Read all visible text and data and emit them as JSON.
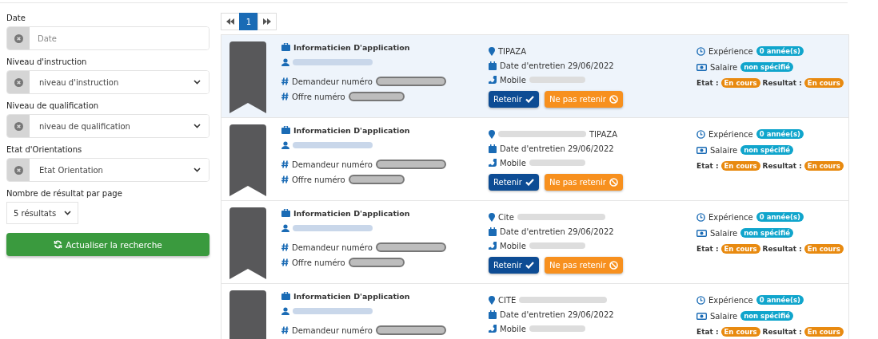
{
  "filters": [
    {
      "kind": "input",
      "label": "Date",
      "placeholder": "Date"
    },
    {
      "kind": "select",
      "label": "Niveau d'instruction",
      "value": "niveau d'instruction"
    },
    {
      "kind": "select",
      "label": "Niveau de qualification",
      "value": "niveau de qualification"
    },
    {
      "kind": "select",
      "label": "Etat d'Orientations",
      "value": "Etat Orientation"
    }
  ],
  "per_page": {
    "label": "Nombre de résultat par page",
    "value": "5 résultats"
  },
  "refresh_button": "Actualiser la recherche",
  "pagination": {
    "pages": [
      {
        "label": "1",
        "selected": true
      }
    ]
  },
  "results": [
    {
      "highlighted": true,
      "job": "Informaticien D'application",
      "applicant_label": "Demandeur numéro",
      "offer_label": "Offre numéro",
      "location": [
        {
          "kind": "text",
          "text": "TIPAZA"
        }
      ],
      "interview": "Date d'entretien 29/06/2022",
      "mobile_label": "Mobile",
      "buttons": {
        "accept": "Retenir",
        "reject": "Ne pas retenir"
      },
      "experience_label": "Expérience",
      "experience": "0 année(s)",
      "salary_label": "Salaire",
      "salary": "non spécifié",
      "state_label": "Etat :",
      "state": "En cours",
      "result_label": "Resultat :",
      "result": "En cours"
    },
    {
      "highlighted": false,
      "job": "Informaticien D'application",
      "applicant_label": "Demandeur numéro",
      "offer_label": "Offre numéro",
      "location": [
        {
          "kind": "redacted"
        },
        {
          "kind": "text",
          "text": "TIPAZA"
        }
      ],
      "interview": "Date d'entretien 29/06/2022",
      "mobile_label": "Mobile",
      "buttons": {
        "accept": "Retenir",
        "reject": "Ne pas retenir"
      },
      "experience_label": "Expérience",
      "experience": "0 année(s)",
      "salary_label": "Salaire",
      "salary": "non spécifié",
      "state_label": "Etat :",
      "state": "En cours",
      "result_label": "Resultat :",
      "result": "En cours"
    },
    {
      "highlighted": false,
      "job": "Informaticien D'application",
      "applicant_label": "Demandeur numéro",
      "offer_label": "Offre numéro",
      "location": [
        {
          "kind": "text",
          "text": "Cite"
        },
        {
          "kind": "redacted"
        }
      ],
      "interview": "Date d'entretien 29/06/2022",
      "mobile_label": "Mobile",
      "buttons": {
        "accept": "Retenir",
        "reject": "Ne pas retenir"
      },
      "experience_label": "Expérience",
      "experience": "0 année(s)",
      "salary_label": "Salaire",
      "salary": "non spécifié",
      "state_label": "Etat :",
      "state": "En cours",
      "result_label": "Resultat :",
      "result": "En cours"
    },
    {
      "highlighted": false,
      "job": "Informaticien D'application",
      "applicant_label": "Demandeur numéro",
      "location": [
        {
          "kind": "text",
          "text": "CITE"
        },
        {
          "kind": "redacted"
        }
      ],
      "interview": "Date d'entretien 29/06/2022",
      "mobile_label": "Mobile",
      "experience_label": "Expérience",
      "experience": "0 année(s)",
      "salary_label": "Salaire",
      "salary": "non spécifié",
      "state_label": "Etat :",
      "state": "En cours",
      "result_label": "Resultat :",
      "result": "En cours"
    }
  ]
}
